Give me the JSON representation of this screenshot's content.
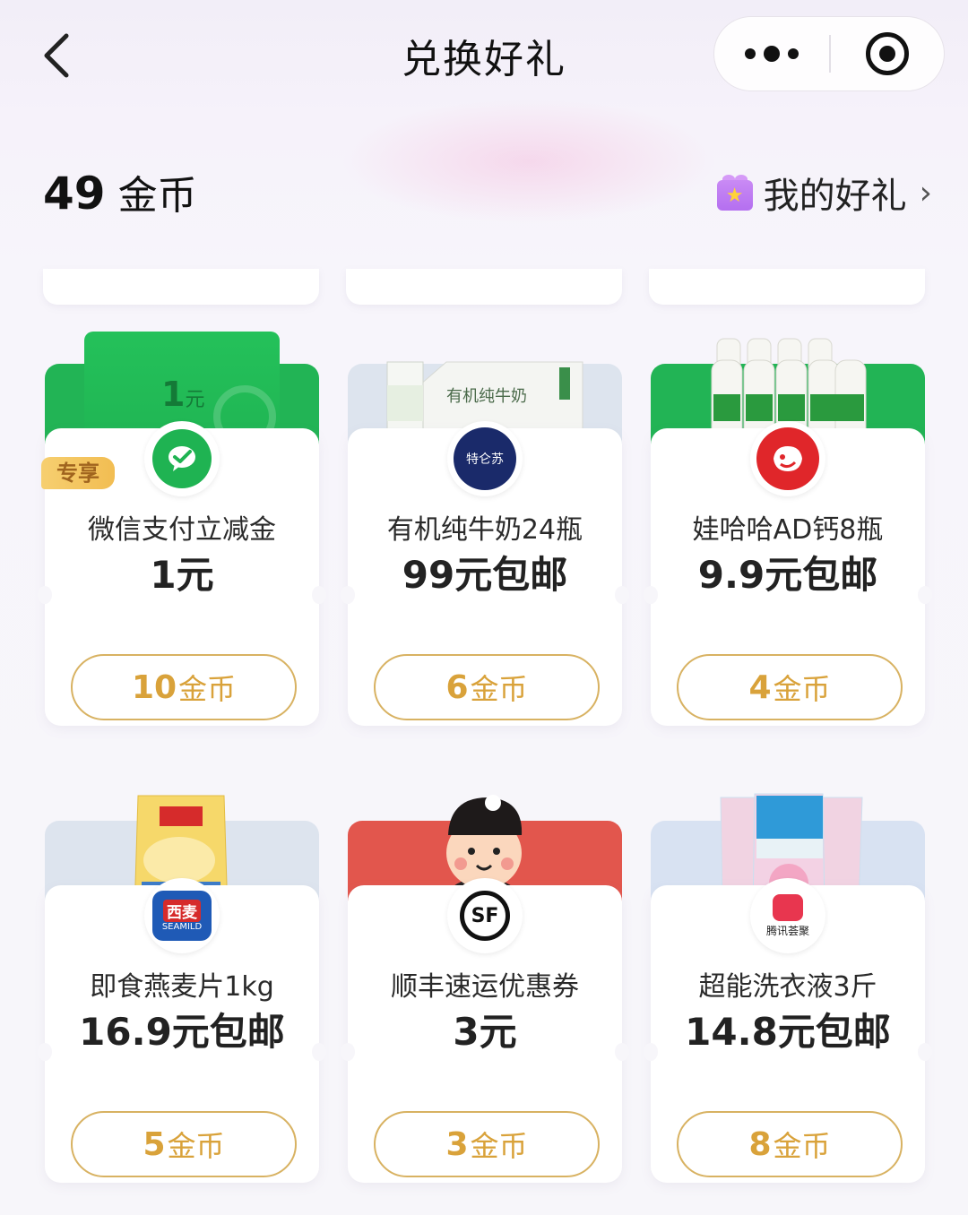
{
  "header": {
    "title": "兑换好礼"
  },
  "coins": {
    "amount": "49",
    "unit": "金币"
  },
  "my_gifts": {
    "label": "我的好礼",
    "chevron": "›"
  },
  "products": [
    {
      "name": "微信支付立减金",
      "price": "1元",
      "cost": "10",
      "cost_unit": "金币",
      "badge": "专享",
      "banner_amount": "1",
      "banner_unit": "元",
      "logo": "wechat-pay-icon",
      "banner_color": "#22b455"
    },
    {
      "name": "有机纯牛奶24瓶",
      "price": "99元包邮",
      "cost": "6",
      "cost_unit": "金币",
      "logo": "telunsu-logo",
      "logo_text": "特仑苏",
      "banner_color": "#dde4ee"
    },
    {
      "name": "娃哈哈AD钙8瓶",
      "price": "9.9元包邮",
      "cost": "4",
      "cost_unit": "金币",
      "logo": "jd-logo",
      "banner_color": "#22b455"
    },
    {
      "name": "即食燕麦片1kg",
      "price": "16.9元包邮",
      "cost": "5",
      "cost_unit": "金币",
      "logo": "seamild-logo",
      "logo_text": "西麦",
      "logo_subtext": "SEAMILD",
      "banner_color": "#dde4ee"
    },
    {
      "name": "顺丰速运优惠券",
      "price": "3元",
      "cost": "3",
      "cost_unit": "金币",
      "logo": "sf-logo",
      "logo_text": "SF",
      "banner_color": "#e2564d"
    },
    {
      "name": "超能洗衣液3斤",
      "price": "14.8元包邮",
      "cost": "8",
      "cost_unit": "金币",
      "logo": "tencent-huiju-logo",
      "logo_text": "腾讯荟聚",
      "banner_color": "#d8e2f2"
    }
  ]
}
